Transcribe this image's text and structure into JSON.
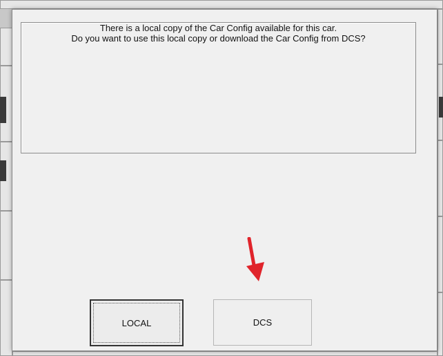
{
  "dialog": {
    "message_line1": "There is a local copy of the Car Config available for this car.",
    "message_line2": "Do you want to use this local copy or download the Car Config from DCS?",
    "buttons": {
      "local": "LOCAL",
      "dcs": "DCS"
    }
  },
  "colors": {
    "arrow": "#e0242b"
  }
}
